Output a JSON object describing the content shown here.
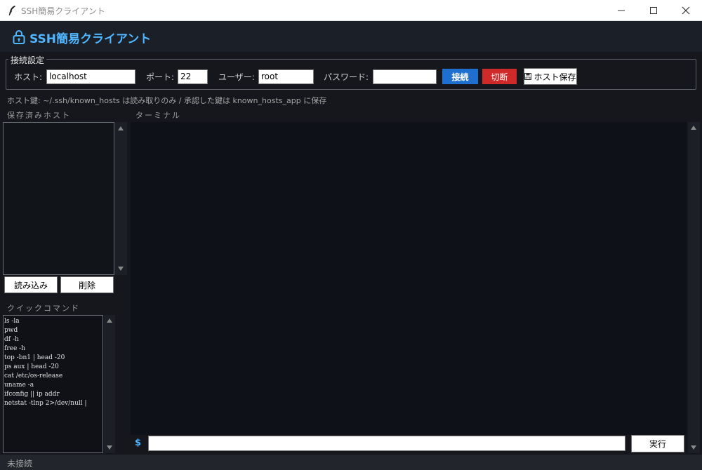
{
  "window": {
    "title": "SSH簡易クライアント"
  },
  "header": {
    "title": "SSH簡易クライアント",
    "accent": "#4fb6ff"
  },
  "connection": {
    "legend": "接続設定",
    "host_label": "ホスト:",
    "host_value": "localhost",
    "port_label": "ポート:",
    "port_value": "22",
    "user_label": "ユーザー:",
    "user_value": "root",
    "password_label": "パスワード:",
    "password_value": "",
    "connect_label": "接続",
    "disconnect_label": "切断",
    "save_host_label": "ホスト保存",
    "connect_color": "#1f6fd1",
    "disconnect_color": "#cf2a2a"
  },
  "hint": "ホスト鍵: ~/.ssh/known_hosts は読み取りのみ / 承認した鍵は known_hosts_app に保存",
  "saved_hosts": {
    "title": "保存済みホスト",
    "items": [],
    "load_label": "読み込み",
    "delete_label": "削除"
  },
  "quick_commands": {
    "title": "クイックコマンド",
    "items": [
      "ls -la",
      "pwd",
      "df -h",
      "free -h",
      "top -bn1 | head -20",
      "ps aux | head -20",
      "cat /etc/os-release",
      "uname -a",
      "ifconfig || ip addr",
      "netstat -tlnp 2>/dev/null |"
    ]
  },
  "terminal": {
    "title": "ターミナル",
    "prompt": "$",
    "input_value": "",
    "run_label": "実行"
  },
  "status": {
    "text": "未接続"
  }
}
